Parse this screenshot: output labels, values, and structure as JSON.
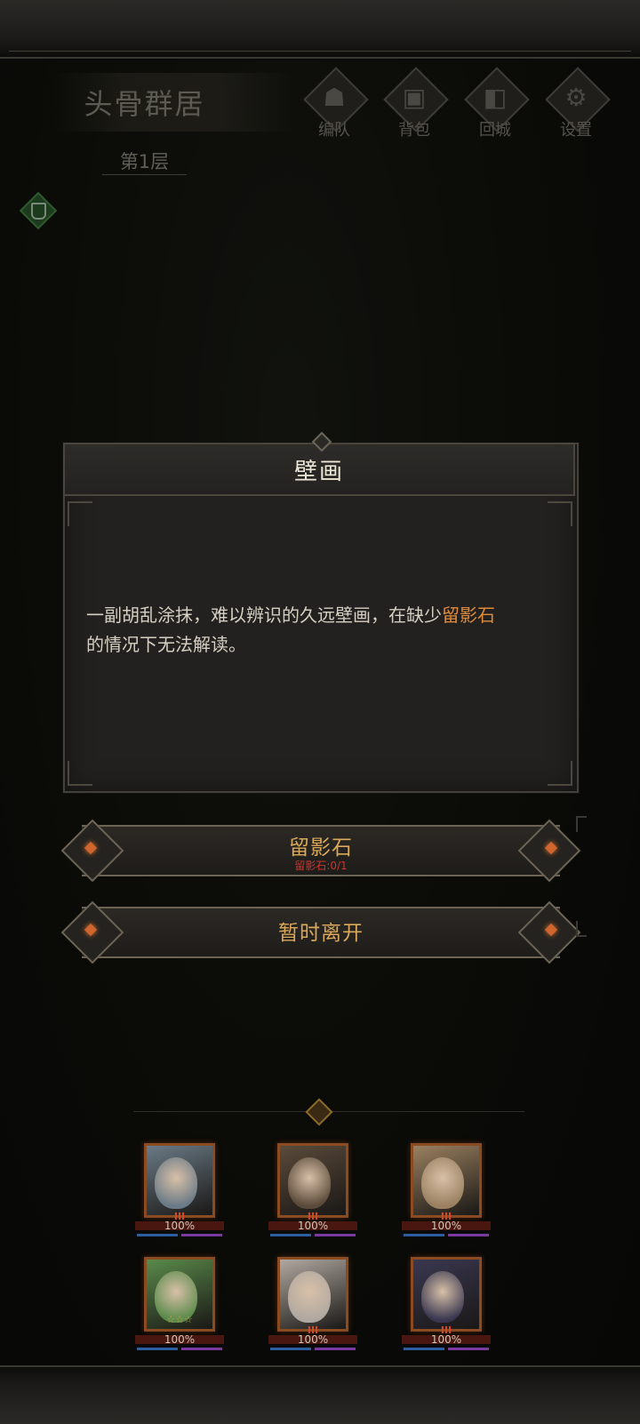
{
  "header": {
    "location_name": "头骨群居",
    "floor": "第1层"
  },
  "menu": [
    {
      "label": "编队",
      "icon": "horned-helmet-icon"
    },
    {
      "label": "背包",
      "icon": "backpack-icon"
    },
    {
      "label": "回城",
      "icon": "exit-door-icon"
    },
    {
      "label": "设置",
      "icon": "gear-icon"
    }
  ],
  "dialog": {
    "title": "壁画",
    "body_before": "一副胡乱涂抹，难以辨识的久远壁画，在缺少",
    "body_highlight": "留影石",
    "body_after": "的情况下无法解读。"
  },
  "actions": {
    "use_item": {
      "label": "留影石",
      "requirement": "留影石:0/1"
    },
    "leave": {
      "label": "暂时离开"
    }
  },
  "team": {
    "heroes": [
      {
        "rank": "III",
        "hp": "100%",
        "hp_fraction": 1.0,
        "stars": "",
        "tint": "#6a7a86"
      },
      {
        "rank": "III",
        "hp": "100%",
        "hp_fraction": 1.0,
        "stars": "",
        "tint": "#5a4a3a"
      },
      {
        "rank": "III",
        "hp": "100%",
        "hp_fraction": 1.0,
        "stars": "",
        "tint": "#9a8060"
      },
      {
        "rank": "",
        "hp": "100%",
        "hp_fraction": 1.0,
        "stars": "☆☆☆",
        "tint": "#5a8a4a"
      },
      {
        "rank": "III",
        "hp": "100%",
        "hp_fraction": 1.0,
        "stars": "",
        "tint": "#b0a8a0"
      },
      {
        "rank": "III",
        "hp": "100%",
        "hp_fraction": 1.0,
        "stars": "",
        "tint": "#3a3850"
      }
    ]
  },
  "colors": {
    "highlight": "#e08a3a",
    "requirement_red": "#d0342c",
    "button_text": "#d9a85a"
  }
}
